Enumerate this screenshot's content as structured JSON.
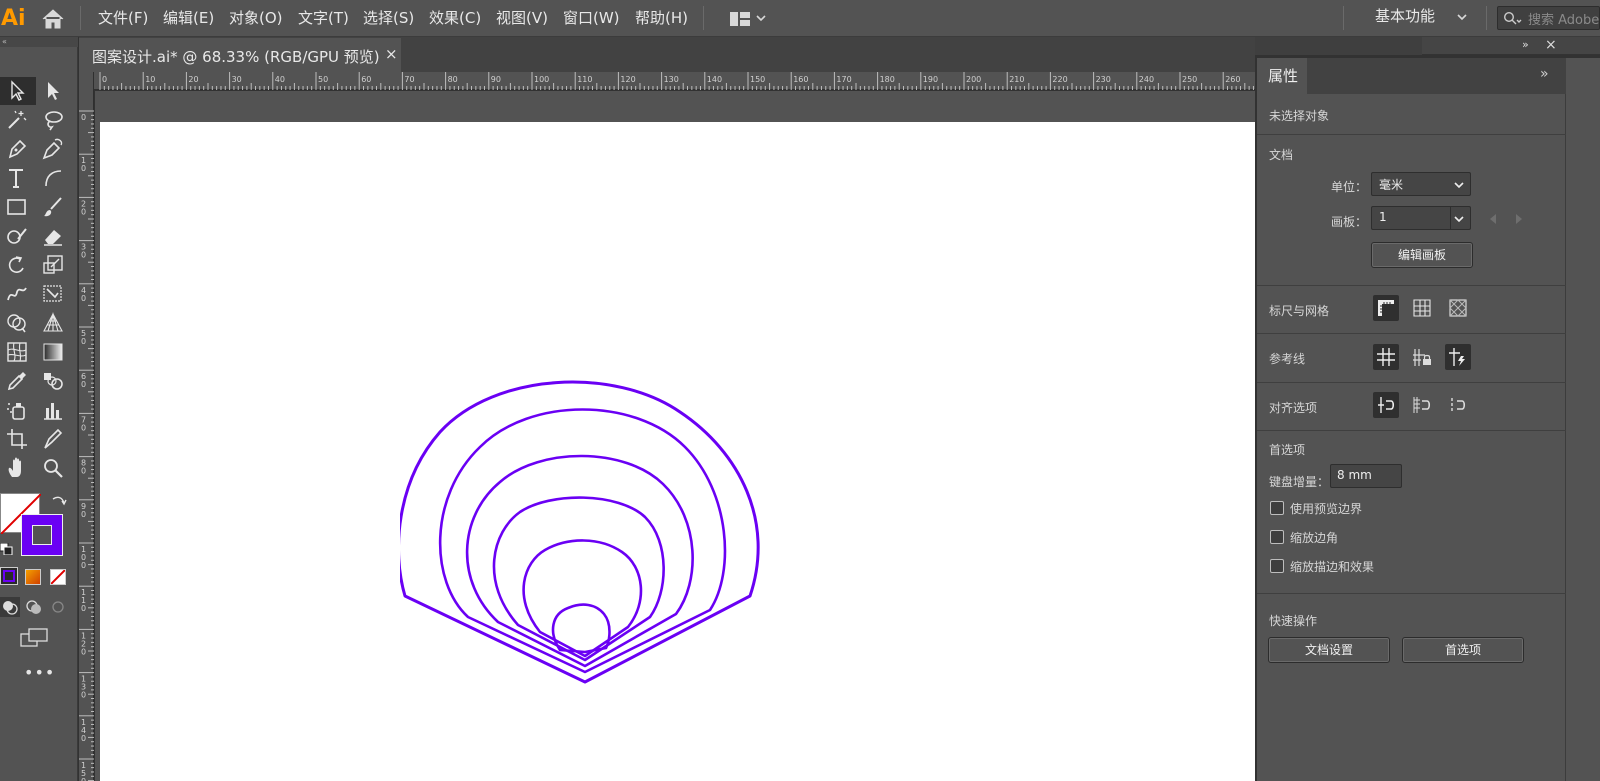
{
  "app": {
    "logo": "Ai"
  },
  "menu": [
    "文件(F)",
    "编辑(E)",
    "对象(O)",
    "文字(T)",
    "选择(S)",
    "效果(C)",
    "视图(V)",
    "窗口(W)",
    "帮助(H)"
  ],
  "header": {
    "workspace": "基本功能",
    "search_placeholder": "搜索 Adobe"
  },
  "document": {
    "tab_title": "图案设计.ai* @ 68.33% (RGB/GPU 预览)",
    "close": "×"
  },
  "rulers": {
    "horizontal": [
      "0",
      "10",
      "20",
      "30",
      "40",
      "50",
      "60",
      "70",
      "80",
      "90",
      "100",
      "110",
      "120",
      "130",
      "140",
      "150",
      "160",
      "170",
      "180",
      "190",
      "200",
      "210",
      "220",
      "230",
      "240",
      "250",
      "260"
    ],
    "vertical": [
      "0",
      "1 0",
      "2 0",
      "3 0",
      "4 0",
      "5 0",
      "6 0",
      "7 0",
      "8 0",
      "9 0",
      "1 0 0",
      "1 1 0",
      "1 2 0",
      "1 3 0",
      "1 4 0",
      "1 5 0"
    ]
  },
  "properties": {
    "tab": "属性",
    "selection_state": "未选择对象",
    "document_section": "文档",
    "units_label": "单位：",
    "units_value": "毫米",
    "artboard_label": "画板：",
    "artboard_value": "1",
    "edit_artboards": "编辑画板",
    "rulers_grids": "标尺与网格",
    "guides": "参考线",
    "snap_options": "对齐选项",
    "preferences_section": "首选项",
    "keyboard_increment_label": "键盘增量：",
    "keyboard_increment_value": "8 mm",
    "use_preview_bounds": "使用预览边界",
    "scale_corners": "缩放边角",
    "scale_strokes_effects": "缩放描边和效果",
    "quick_actions": "快速操作",
    "doc_setup": "文档设置",
    "preferences_button": "首选项"
  },
  "colors": {
    "stroke": "#6a00f4",
    "accent": "#ff9a00"
  }
}
